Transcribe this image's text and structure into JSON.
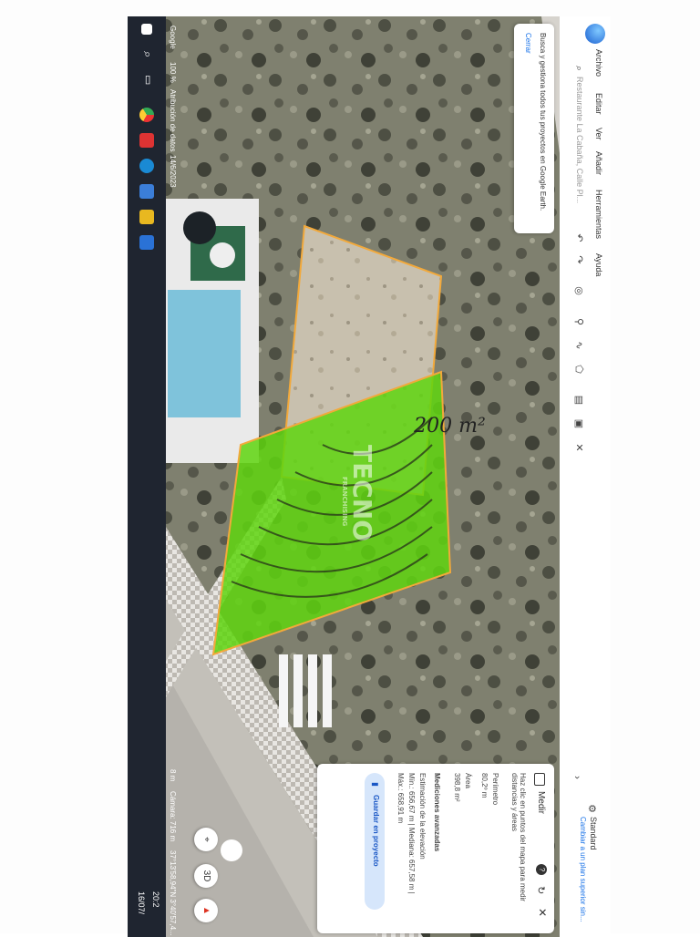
{
  "app": {
    "menu": [
      "Archivo",
      "Editar",
      "Ver",
      "Añadir",
      "Herramientas",
      "Ayuda"
    ],
    "search_placeholder": "Restaurante La Cabaña, Calle Pl...",
    "standard_title": "Standard",
    "standard_subtitle": "Cambiar a un plan superior sin..."
  },
  "tooltip": {
    "text": "Busca y gestiona todos tus proyectos en Google Earth.",
    "close": "Cerrar"
  },
  "measure": {
    "title": "Medir",
    "instructions": "Haz clic en puntos del mapa para medir distancias y áreas",
    "perimeter_label": "Perímetro",
    "perimeter_value": "80,2º m",
    "area_label": "Área",
    "area_value": "398,8 m²",
    "advanced_label": "Mediciones avanzadas",
    "elevation_label": "Estimación de la elevación",
    "elevation_values": "Mín.: 656,67 m | Mediana: 657,58 m |",
    "elevation_max": "Máx.: 658,91 m",
    "save_button": "Guardar en proyecto"
  },
  "annotation": {
    "handwritten": "200 m²",
    "watermark": "TECNO",
    "watermark_sub": "FRANCHISING"
  },
  "status": {
    "google": "Google",
    "zoom": "100 %",
    "attribution": "Atribución de datos",
    "date": "14/6/2023",
    "scale": "8 m",
    "camera": "Cámara: 716 m",
    "coords": "37°13'58,94\"N 3°40'57,4...",
    "view_3d": "3D",
    "clock_time": "20:2",
    "clock_date": "16/07/"
  },
  "colors": {
    "highlight": "#5fd50f",
    "outline": "#f2a93b",
    "accent": "#1a73e8",
    "taskbar": "#1f2530"
  }
}
